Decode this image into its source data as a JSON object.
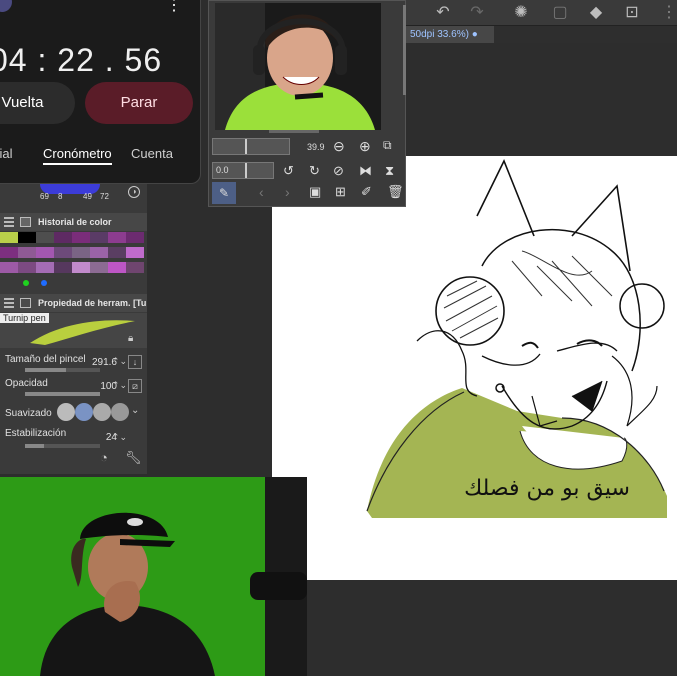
{
  "stopwatch": {
    "time": "04 : 22 . 56",
    "lap_label": "Vuelta",
    "stop_label": "Parar",
    "tabs": [
      "ndial",
      "Cronómetro",
      "Cuenta"
    ],
    "active_tab": "Cronómetro"
  },
  "app": {
    "document_tab": "50dpi 33.6%)",
    "navigator": {
      "zoom_value": "39.9",
      "rotation_value": "0.0"
    },
    "color_history": {
      "title": "Historial de color",
      "rgb_values": [
        "69",
        "8",
        "49",
        "72"
      ],
      "swatches": [
        "#b9d04a",
        "#000000",
        "#4e4e4e",
        "#5e2a63",
        "#7a2d7a",
        "#5a3b66",
        "#8c3c8f",
        "#6c2b70",
        "#7d2f80",
        "#8f5a95",
        "#a357b0",
        "#6d4a7a",
        "#7a6485",
        "#9b63a8",
        "#5a3e62",
        "#c06bcc",
        "#9d5aa6",
        "#7c4a82",
        "#a46cb5",
        "#56385e",
        "#c18acb",
        "#8c6b93",
        "#bd56c5",
        "#6f456f"
      ]
    },
    "tool_property": {
      "title": "Propiedad de herram. [Tu",
      "brush_name": "Turnip pen",
      "brush_size_label": "Tamaño del pincel",
      "brush_size_value": "291.6",
      "brush_size_fill": 0.55,
      "opacity_label": "Opacidad",
      "opacity_value": "100",
      "opacity_fill": 1.0,
      "smoothing_label": "Suavizado",
      "stabilization_label": "Estabilización",
      "stabilization_value": "24"
    },
    "canvas": {
      "caption": "سيق بو من فصلك",
      "accent_color": "#a4b553"
    }
  }
}
